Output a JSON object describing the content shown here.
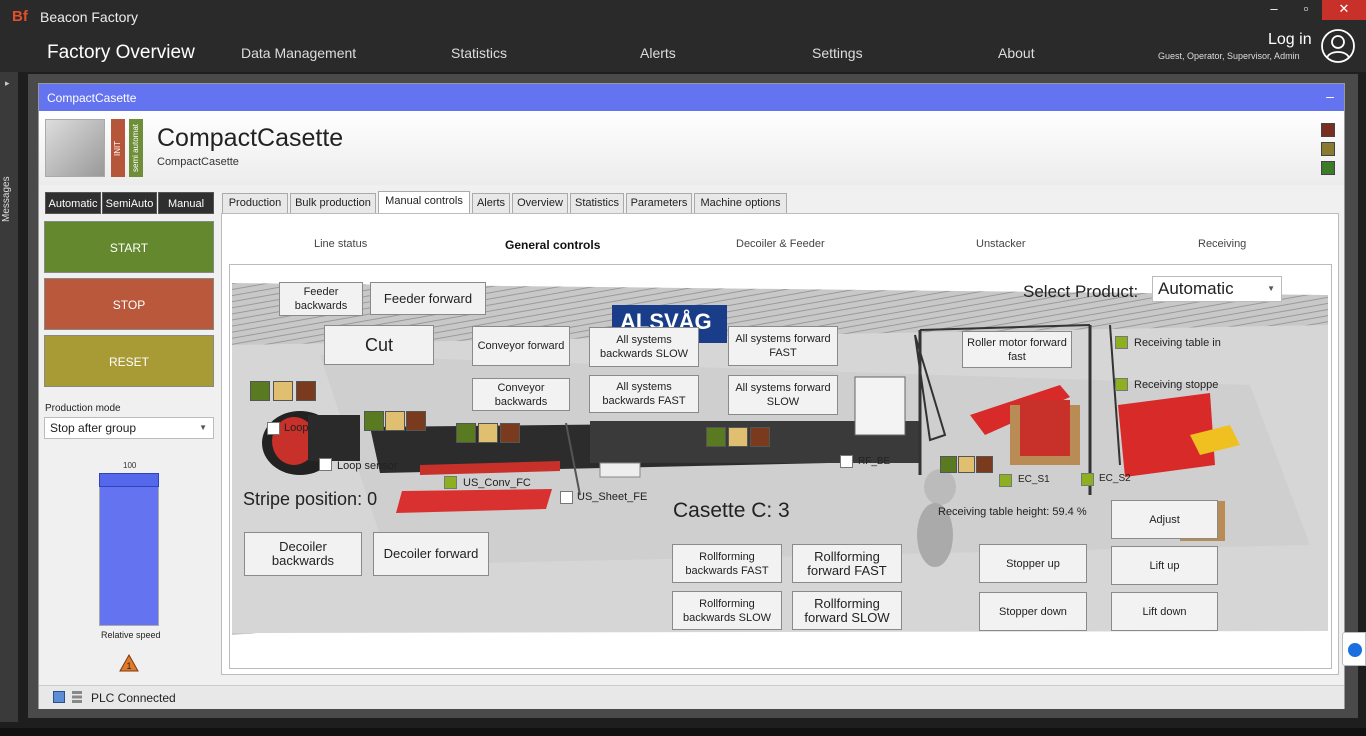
{
  "app": {
    "logo": "Bf",
    "title": "Beacon Factory"
  },
  "window_controls": {
    "minimize": "–",
    "maximize": "▫",
    "close": "✕"
  },
  "nav": {
    "title": "Factory Overview",
    "items": [
      "Data Management",
      "Statistics",
      "Alerts",
      "Settings",
      "About"
    ],
    "login": "Log in",
    "roles": "Guest, Operator, Supervisor, Admin"
  },
  "messages_side": {
    "label": "Messages",
    "arrow": "▸"
  },
  "window": {
    "title": "CompactCasette",
    "collapse": "–"
  },
  "machine": {
    "name": "CompactCasette",
    "subtitle": "CompactCasette",
    "state_init": "INIT",
    "state_mode": "semi automat",
    "legend_colors": [
      "#7a2e22",
      "#8a7a30",
      "#3e7a2a"
    ]
  },
  "modes": [
    "Automatic",
    "SemiAuto",
    "Manual"
  ],
  "controls": {
    "start": "START",
    "stop": "STOP",
    "reset": "RESET"
  },
  "production_mode": {
    "label": "Production mode",
    "value": "Stop after group"
  },
  "speed": {
    "max_label": "100",
    "label": "Relative speed",
    "value_percent": 100
  },
  "warning": {
    "count": "1"
  },
  "tabs": [
    "Production",
    "Bulk production",
    "Manual controls",
    "Alerts",
    "Overview",
    "Statistics",
    "Parameters",
    "Machine options"
  ],
  "active_tab": "Manual controls",
  "subtabs": [
    "Line status",
    "General controls",
    "Decoiler & Feeder",
    "Unstacker",
    "Receiving"
  ],
  "scene": {
    "select_product_label": "Select Product:",
    "product_value": "Automatic",
    "brand": "ALSVÅG",
    "stripe_position": "Stripe position: 0",
    "casette": "Casette C: 3",
    "receiving_height": "Receiving table height: 59.4 %",
    "buttons": {
      "feeder_backwards": "Feeder backwards",
      "feeder_forward": "Feeder forward",
      "cut": "Cut",
      "conveyor_forward": "Conveyor forward",
      "conveyor_backwards": "Conveyor backwards",
      "all_back_slow": "All systems backwards SLOW",
      "all_back_fast": "All systems backwards FAST",
      "all_fwd_fast": "All systems forward FAST",
      "all_fwd_slow": "All systems forward SLOW",
      "roller_motor_fast": "Roller motor forward fast",
      "decoiler_backwards": "Decoiler backwards",
      "decoiler_forward": "Decoiler forward",
      "rf_back_fast": "Rollforming backwards FAST",
      "rf_fwd_fast": "Rollforming forward FAST",
      "rf_back_slow": "Rollforming backwards SLOW",
      "rf_fwd_slow": "Rollforming forward SLOW",
      "stopper_up": "Stopper up",
      "stopper_down": "Stopper down",
      "adjust": "Adjust",
      "lift_up": "Lift up",
      "lift_down": "Lift down"
    },
    "sensors": {
      "loop": "Loop",
      "loop_sensor": "Loop sensor",
      "us_conv_fc": "US_Conv_FC",
      "us_sheet_fe": "US_Sheet_FE",
      "rf_be": "RF_BE",
      "ec_s1": "EC_S1",
      "ec_s2": "EC_S2",
      "receiving_table_in": "Receiving table in",
      "receiving_stopper": "Receiving stoppe"
    },
    "indicator_colors": [
      "#5a7a22",
      "#e0c070",
      "#7a3a1e"
    ]
  },
  "status": {
    "plc": "PLC Connected"
  }
}
